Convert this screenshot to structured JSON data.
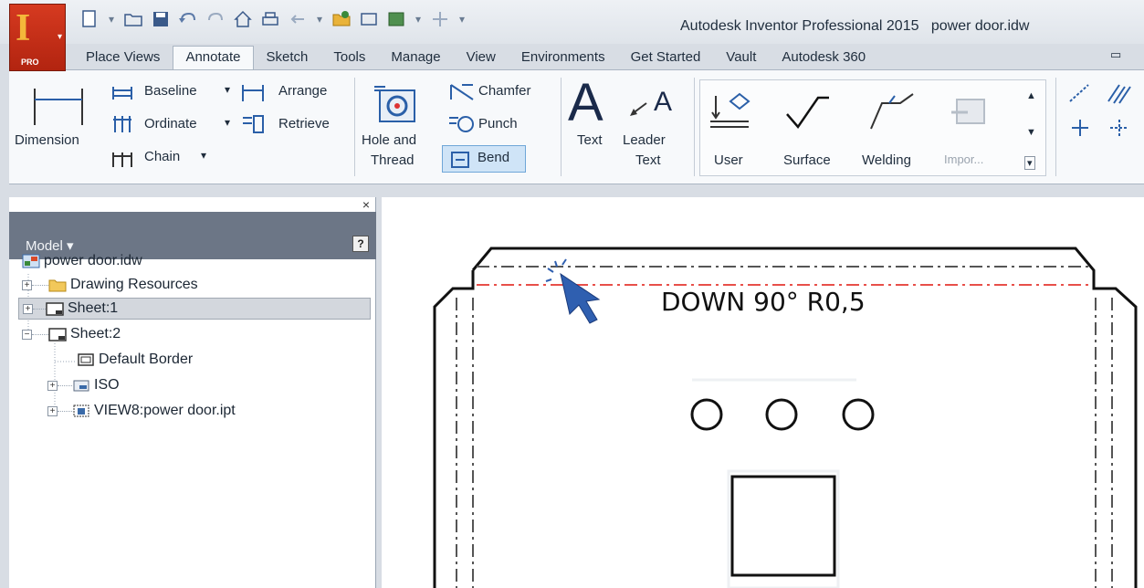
{
  "app": {
    "logo_letter": "I",
    "logo_badge": "PRO",
    "window_title": "Autodesk Inventor Professional 2015   power door.idw"
  },
  "quick_access": [
    "new-icon",
    "open-icon",
    "save-icon",
    "undo-icon",
    "redo-icon",
    "home-icon",
    "print-icon",
    "back-icon",
    "folder-icon",
    "image-icon",
    "view-icon",
    "add-icon",
    "customize-icon"
  ],
  "tabs": [
    {
      "label": "Place Views"
    },
    {
      "label": "Annotate"
    },
    {
      "label": "Sketch"
    },
    {
      "label": "Tools"
    },
    {
      "label": "Manage"
    },
    {
      "label": "View"
    },
    {
      "label": "Environments"
    },
    {
      "label": "Get Started"
    },
    {
      "label": "Vault"
    },
    {
      "label": "Autodesk 360"
    }
  ],
  "active_tab": "Annotate",
  "ribbon": {
    "dimension": "Dimension",
    "baseline": "Baseline",
    "ordinate": "Ordinate",
    "chain": "Chain",
    "arrange": "Arrange",
    "retrieve": "Retrieve",
    "hole_and": "Hole and",
    "thread": "Thread",
    "chamfer": "Chamfer",
    "punch": "Punch",
    "bend": "Bend",
    "text": "Text",
    "leader": "Leader",
    "leader_text": "Text",
    "user": "User",
    "surface": "Surface",
    "welding": "Welding",
    "import": "Impor..."
  },
  "model_panel": {
    "title": "Model",
    "close": "×",
    "help": "?",
    "tree": [
      {
        "label": "power door.idw",
        "icon": "drawing-file-icon",
        "level": 0
      },
      {
        "label": "Drawing Resources",
        "icon": "folder-icon",
        "level": 1
      },
      {
        "label": "Sheet:1",
        "icon": "sheet-icon",
        "level": 1,
        "selected": true
      },
      {
        "label": "Sheet:2",
        "icon": "sheet-icon",
        "level": 1
      },
      {
        "label": "Default Border",
        "icon": "border-icon",
        "level": 2
      },
      {
        "label": "ISO",
        "icon": "title-block-icon",
        "level": 2
      },
      {
        "label": "VIEW8:power door.ipt",
        "icon": "view-icon",
        "level": 2
      }
    ]
  },
  "canvas": {
    "bend_note": "DOWN 90° R0,5",
    "bend_line_color": "#e8504a"
  }
}
